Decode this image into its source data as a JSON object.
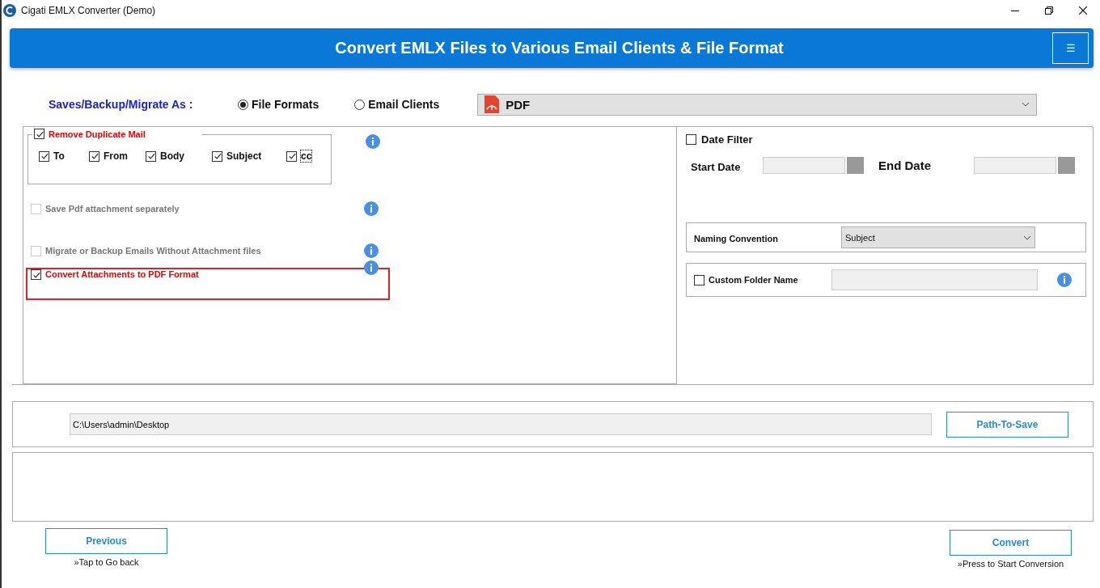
{
  "window": {
    "title": "Cigati EMLX Converter (Demo)"
  },
  "header": {
    "title": "Convert EMLX Files to Various Email Clients & File Format",
    "menu_button": "☰"
  },
  "save_as": {
    "label": "Saves/Backup/Migrate As :",
    "options": [
      {
        "label": "File Formats",
        "selected": true
      },
      {
        "label": "Email Clients",
        "selected": false
      }
    ],
    "format": "PDF"
  },
  "remove_duplicates": {
    "label": "Remove Duplicate Mail",
    "checked": true,
    "fields": [
      {
        "label": "To",
        "checked": true,
        "focused": false
      },
      {
        "label": "From",
        "checked": true,
        "focused": false
      },
      {
        "label": "Body",
        "checked": true,
        "focused": false
      },
      {
        "label": "Subject",
        "checked": true,
        "focused": false
      },
      {
        "label": "cc",
        "checked": true,
        "focused": true
      }
    ]
  },
  "options": [
    {
      "label": "Save Pdf attachment separately",
      "checked": false,
      "disabled": true,
      "highlighted": false
    },
    {
      "label": "Migrate or Backup Emails Without Attachment files",
      "checked": false,
      "disabled": true,
      "highlighted": false
    },
    {
      "label": "Convert Attachments to PDF Format",
      "checked": true,
      "disabled": false,
      "highlighted": true
    }
  ],
  "date_filter": {
    "label": "Date Filter",
    "checked": false,
    "start_label": "Start Date",
    "end_label": "End Date"
  },
  "naming_convention": {
    "label": "Naming Convention",
    "value": "Subject"
  },
  "custom_folder": {
    "label": "Custom Folder Name",
    "checked": false
  },
  "path": {
    "value": "C:\\Users\\admin\\Desktop",
    "button": "Path-To-Save"
  },
  "previous": {
    "label": "Previous",
    "hint": "»Tap to Go back"
  },
  "convert": {
    "label": "Convert",
    "hint": "»Press to Start Conversion"
  }
}
